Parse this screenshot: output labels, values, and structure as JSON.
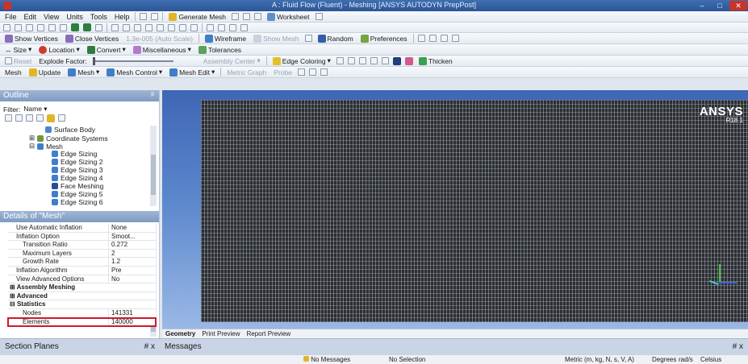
{
  "window": {
    "title": "A : Fluid Flow (Fluent) - Meshing [ANSYS AUTODYN PrepPost]",
    "minimize": "–",
    "maximize": "□",
    "close": "✕"
  },
  "menu": [
    "File",
    "Edit",
    "View",
    "Units",
    "Tools",
    "Help"
  ],
  "toolbar1": {
    "generate_mesh": "Generate Mesh",
    "worksheet": "Worksheet"
  },
  "toolbar3": {
    "show_vertices": "Show Vertices",
    "close_vertices": "Close Vertices",
    "auto_scale": "1.3e-005 (Auto Scale)",
    "wireframe": "Wireframe",
    "show_mesh": "Show Mesh",
    "random": "Random",
    "preferences": "Preferences"
  },
  "toolbar4": {
    "size": "Size",
    "location": "Location",
    "convert": "Convert",
    "miscellaneous": "Miscellaneous",
    "tolerances": "Tolerances"
  },
  "toolbar5": {
    "reset": "Reset",
    "explode_factor": "Explode Factor:",
    "assembly_center": "Assembly Center",
    "edge_coloring": "Edge Coloring",
    "thicken": "Thicken"
  },
  "toolbar6": {
    "mesh": "Mesh",
    "update": "Update",
    "mesh_dd": "Mesh",
    "mesh_control": "Mesh Control",
    "mesh_edit": "Mesh Edit",
    "metric_graph": "Metric Graph",
    "probe": "Probe"
  },
  "outline": {
    "title": "Outline",
    "filter_label": "Filter:",
    "filter_value": "Name",
    "items": [
      "Surface Body",
      "Coordinate Systems",
      "Mesh",
      "Edge Sizing",
      "Edge Sizing 2",
      "Edge Sizing 3",
      "Edge Sizing 4",
      "Face Meshing",
      "Edge Sizing 5",
      "Edge Sizing 6"
    ]
  },
  "details": {
    "title": "Details of \"Mesh\"",
    "rows": [
      {
        "k": "Use Automatic Inflation",
        "v": "None"
      },
      {
        "k": "Inflation Option",
        "v": "Smoot..."
      },
      {
        "k": "Transition Ratio",
        "v": "0.272"
      },
      {
        "k": "Maximum Layers",
        "v": "2"
      },
      {
        "k": "Growth Rate",
        "v": "1.2"
      },
      {
        "k": "Inflation Algorithm",
        "v": "Pre"
      },
      {
        "k": "View Advanced Options",
        "v": "No"
      },
      {
        "k": "Assembly Meshing",
        "v": ""
      },
      {
        "k": "Advanced",
        "v": ""
      },
      {
        "k": "Statistics",
        "v": ""
      },
      {
        "k": "Nodes",
        "v": "141331"
      },
      {
        "k": "Elements",
        "v": "140000"
      }
    ]
  },
  "viewport": {
    "brand": "ANSYS",
    "version": "R18.1"
  },
  "viewtabs": [
    "Geometry",
    "Print Preview",
    "Report Preview"
  ],
  "bottom": {
    "section_planes": "Section Planes",
    "pin": "# x",
    "messages": "Messages",
    "pin2": "# x"
  },
  "status": {
    "messages": "No Messages",
    "selection": "No Selection",
    "units": "Metric (m, kg, N, s, V, A)",
    "degrees": "Degrees",
    "rads": "rad/s",
    "temp": "Celsius"
  },
  "colors": {
    "accent": "#2b5597",
    "viewport_top": "#3f66b6",
    "mesh": "#2a2e33",
    "highlight_box": "#d0182a"
  }
}
